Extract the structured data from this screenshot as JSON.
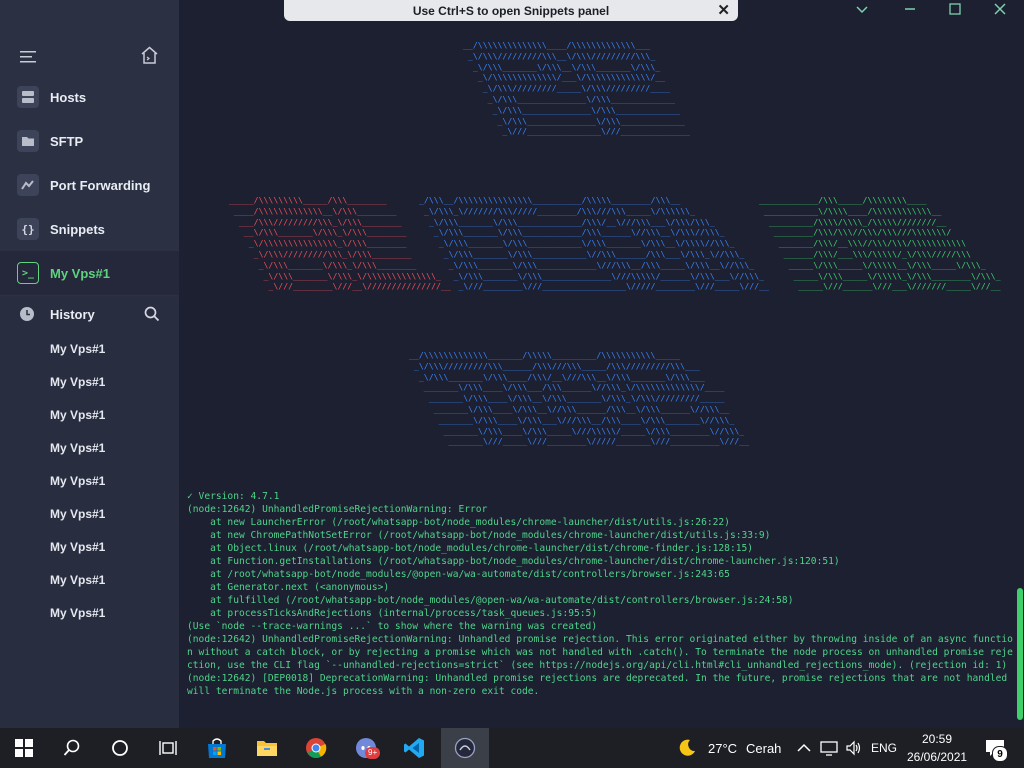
{
  "banner": {
    "text": "Use Ctrl+S to open Snippets panel"
  },
  "sidebar": {
    "nav": [
      {
        "label": "Hosts",
        "icon": "hosts-icon"
      },
      {
        "label": "SFTP",
        "icon": "folder-icon"
      },
      {
        "label": "Port Forwarding",
        "icon": "port-forwarding-icon"
      },
      {
        "label": "Snippets",
        "icon": "braces-icon"
      },
      {
        "label": "My Vps#1",
        "icon": "terminal-icon",
        "active": true
      }
    ],
    "history": {
      "title": "History",
      "items": [
        "My Vps#1",
        "My Vps#1",
        "My Vps#1",
        "My Vps#1",
        "My Vps#1",
        "My Vps#1",
        "My Vps#1",
        "My Vps#1",
        "My Vps#1"
      ]
    }
  },
  "terminal": {
    "ascii_art": {
      "top": "__/\\\\\\\\\\\\\\\\\\\\\\\\\\\\____/\\\\\\\\\\\\\\\\\\\\\\\\\\___\n _\\/\\\\\\/////////\\\\\\__\\/\\\\\\/////////\\\\\\_\n  _\\/\\\\\\_______\\/\\\\\\__\\/\\\\\\_______\\/\\\\\\_\n   _\\/\\\\\\\\\\\\\\\\\\\\\\\\\\/___\\/\\\\\\\\\\\\\\\\\\\\\\\\\\/__\n    _\\/\\\\\\/////////_____\\/\\\\\\/////////____\n     _\\/\\\\\\______________\\/\\\\\\_____________\n      _\\/\\\\\\______________\\/\\\\\\_____________\n       _\\/\\\\\\______________\\/\\\\\\_____________\n        _\\///_______________\\///______________",
      "middle_red": "_____/\\\\\\\\\\\\\\\\\\_____/\\\\\\________\n ____/\\\\\\\\\\\\\\\\\\\\\\\\\\__\\/\\\\\\________\n  ___/\\\\\\/////////\\\\\\_\\/\\\\\\________\n   __\\/\\\\\\_______\\/\\\\\\_\\/\\\\\\________\n    _\\/\\\\\\\\\\\\\\\\\\\\\\\\\\\\\\_\\/\\\\\\________\n     _\\/\\\\\\/////////\\\\\\_\\/\\\\\\________\n      _\\/\\\\\\_______\\/\\\\\\_\\/\\\\\\________\n       _\\/\\\\\\_______\\/\\\\\\_\\/\\\\\\\\\\\\\\\\\\\\\\\\\\\\_\n        _\\///________\\///__\\///////////////__",
      "middle_blue": "_/\\\\\\__/\\\\\\\\\\\\\\\\\\\\\\\\\\\\\\__________/\\\\\\\\\\________/\\\\\\__\n _\\/\\\\\\_\\///////\\\\\\/////________/\\\\\\///\\\\\\_____\\/\\\\\\\\\\\\_\n  _\\/\\\\\\_______\\/\\\\\\_____________/\\\\\\/__\\///\\\\\\___\\/\\\\\\/\\\\\\_\n   _\\/\\\\\\_______\\/\\\\\\____________/\\\\\\______\\//\\\\\\__\\/\\\\\\//\\\\\\_\n    _\\/\\\\\\_______\\/\\\\\\___________\\/\\\\\\_______\\/\\\\\\__\\/\\\\\\\\//\\\\\\_\n     _\\/\\\\\\_______\\/\\\\\\___________\\//\\\\\\______/\\\\\\___\\/\\\\\\_\\//\\\\\\_\n      _\\/\\\\\\_______\\/\\\\\\____________\\///\\\\\\__/\\\\\\_____\\/\\\\\\__\\//\\\\\\_\n       _\\/\\\\\\_______\\/\\\\\\______________\\///\\\\\\\\\\/______\\/\\\\\\___\\//\\\\\\_\n        _\\///________\\///_________________\\/////________\\///_____\\///__",
      "middle_green": "____________/\\\\\\_____/\\\\\\\\\\\\\\\\____\n ___________\\/\\\\\\\\____/\\\\\\\\\\\\\\\\\\\\\\\\__\n  _________/\\\\\\\\/\\\\\\\\_/\\\\\\\\\\////////__\n   ________/\\\\\\/\\\\\\//\\\\\\/\\\\\\///\\\\\\\\\\\\\\/\n    _______/\\\\\\/__\\\\\\//\\\\\\/\\\\\\/\\\\\\\\\\\\\\\\\\\\\\\n     ______/\\\\\\/___\\\\\\/\\\\\\\\\\/_\\/\\\\\\/////\\\\\\\n      _____\\/\\\\\\_____\\/\\\\\\\\\\__\\/\\\\\\_____\\/\\\\\\_\n       _____\\/\\\\\\_____\\/\\\\\\\\\\_\\/\\\\\\________\\/\\\\\\_\n        _____\\///______\\///___\\///////_____\\///__",
      "bottom": "__/\\\\\\\\\\\\\\\\\\\\\\\\\\_______/\\\\\\\\\\_________/\\\\\\\\\\\\\\\\\\\\\\_____\n _\\/\\\\\\/////////\\\\\\______/\\\\\\///\\\\\\_____/\\\\\\/////////\\\\\\___\n  _\\/\\\\\\_______\\/\\\\\\____/\\\\\\/__\\///\\\\\\__\\/\\\\\\_______\\/\\\\\\___\n   _______\\/\\\\\\____\\/\\\\\\___/\\\\\\______\\//\\\\\\_\\/\\\\\\\\\\\\\\\\\\\\\\\\\\/____\n    _______\\/\\\\\\____\\/\\\\\\__\\/\\\\\\_______\\/\\\\\\_\\/\\\\\\/////////_____\n     _______\\/\\\\\\____\\/\\\\\\__\\//\\\\\\______/\\\\\\__\\/\\\\\\______\\//\\\\\\__\n      _______\\/\\\\\\____\\/\\\\\\___\\///\\\\\\__/\\\\\\____\\/\\\\\\_______\\//\\\\\\_\n       _______\\/\\\\\\____\\/\\\\\\_____\\///\\\\\\\\\\/_____\\/\\\\\\________\\//\\\\\\_\n        _______\\///_____\\///________\\/////_______\\///__________\\///__"
    },
    "log": "✓ Version: 4.7.1\n(node:12642) UnhandledPromiseRejectionWarning: Error\n    at new LauncherError (/root/whatsapp-bot/node_modules/chrome-launcher/dist/utils.js:26:22)\n    at new ChromePathNotSetError (/root/whatsapp-bot/node_modules/chrome-launcher/dist/utils.js:33:9)\n    at Object.linux (/root/whatsapp-bot/node_modules/chrome-launcher/dist/chrome-finder.js:128:15)\n    at Function.getInstallations (/root/whatsapp-bot/node_modules/chrome-launcher/dist/chrome-launcher.js:120:51)\n    at /root/whatsapp-bot/node_modules/@open-wa/wa-automate/dist/controllers/browser.js:243:65\n    at Generator.next (<anonymous>)\n    at fulfilled (/root/whatsapp-bot/node_modules/@open-wa/wa-automate/dist/controllers/browser.js:24:58)\n    at processTicksAndRejections (internal/process/task_queues.js:95:5)\n(Use `node --trace-warnings ...` to show where the warning was created)\n(node:12642) UnhandledPromiseRejectionWarning: Unhandled promise rejection. This error originated either by throwing inside of an async function without a catch block, or by rejecting a promise which was not handled with .catch(). To terminate the node process on unhandled promise rejection, use the CLI flag `--unhandled-rejections=strict` (see https://nodejs.org/api/cli.html#cli_unhandled_rejections_mode). (rejection id: 1)\n(node:12642) [DEP0018] DeprecationWarning: Unhandled promise rejections are deprecated. In the future, promise rejections that are not handled will terminate the Node.js process with a non-zero exit code."
  },
  "taskbar": {
    "weather_temp": "27°C",
    "weather_desc": "Cerah",
    "language": "ENG",
    "time": "20:59",
    "date": "26/06/2021",
    "notification_count": "9",
    "discord_badge": "9+"
  },
  "colors": {
    "accent": "#5fd37e",
    "terminal_text": "#4fd48a",
    "art_blue": "#3b82f6",
    "art_red": "#ef4f5a"
  }
}
